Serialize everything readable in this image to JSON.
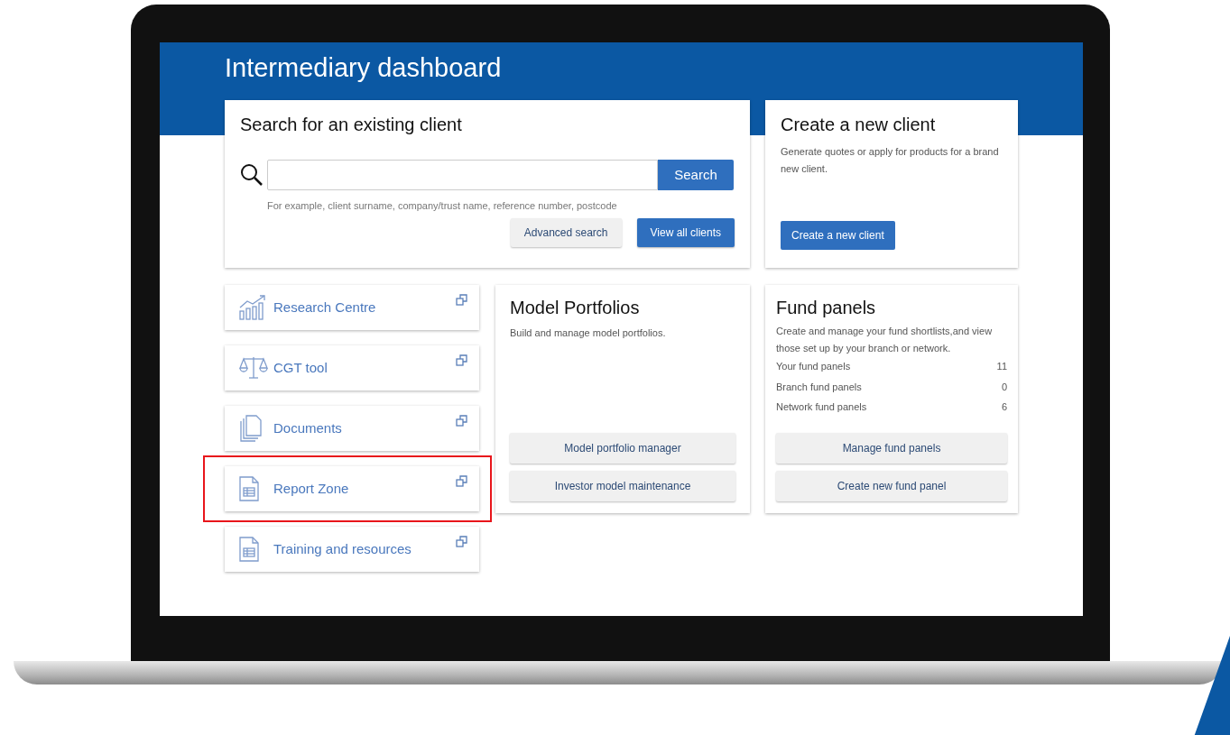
{
  "header": {
    "title": "Intermediary dashboard"
  },
  "search_card": {
    "title": "Search for an existing client",
    "search_button": "Search",
    "help_text": "For example, client surname, company/trust name, reference number, postcode",
    "buttons": [
      {
        "label": "Advanced search",
        "kind": "secondary"
      },
      {
        "label": "View all clients",
        "kind": "primary"
      }
    ]
  },
  "create_card": {
    "title": "Create a new client",
    "description": "Generate quotes or apply for products for a brand new client.",
    "button": "Create a new client"
  },
  "tools": [
    {
      "label": "Research Centre",
      "kind": "chart",
      "highlighted": false
    },
    {
      "label": "CGT tool",
      "kind": "scales",
      "highlighted": false
    },
    {
      "label": "Documents",
      "kind": "documents",
      "highlighted": false
    },
    {
      "label": "Report Zone",
      "kind": "sheet",
      "highlighted": true
    },
    {
      "label": "Training and resources",
      "kind": "sheet",
      "highlighted": false
    }
  ],
  "model_card": {
    "title": "Model Portfolios",
    "description": "Build and manage model portfolios.",
    "buttons": [
      "Model portfolio manager",
      "Investor model maintenance"
    ]
  },
  "fund_card": {
    "title": "Fund panels",
    "description": "Create and manage your fund shortlists,and view those set up by your branch or network.",
    "stats": [
      {
        "label": "Your fund panels",
        "value": "11"
      },
      {
        "label": "Branch fund panels",
        "value": "0"
      },
      {
        "label": "Network fund panels",
        "value": "6"
      }
    ],
    "buttons": [
      "Manage fund panels",
      "Create new fund panel"
    ]
  }
}
